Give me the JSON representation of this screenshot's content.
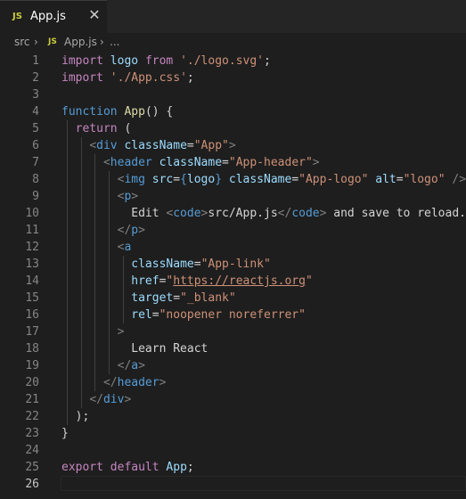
{
  "tab": {
    "icon_label": "JS",
    "file_name": "App.js",
    "close_glyph": "✕"
  },
  "breadcrumb": {
    "folder": "src",
    "sep1": "›",
    "icon_label": "JS",
    "file": "App.js",
    "sep2": "›",
    "ellipsis": "..."
  },
  "editor": {
    "line_numbers": [
      "1",
      "2",
      "3",
      "4",
      "5",
      "6",
      "7",
      "8",
      "9",
      "10",
      "11",
      "12",
      "13",
      "14",
      "15",
      "16",
      "17",
      "18",
      "19",
      "20",
      "21",
      "22",
      "23",
      "24",
      "25",
      "26"
    ],
    "active_line": 26,
    "lines": [
      [
        [
          "kw",
          "import"
        ],
        [
          "txt",
          " "
        ],
        [
          "var",
          "logo"
        ],
        [
          "txt",
          " "
        ],
        [
          "kw",
          "from"
        ],
        [
          "txt",
          " "
        ],
        [
          "str",
          "'./logo.svg'"
        ],
        [
          "txt",
          ";"
        ]
      ],
      [
        [
          "kw",
          "import"
        ],
        [
          "txt",
          " "
        ],
        [
          "str",
          "'./App.css'"
        ],
        [
          "txt",
          ";"
        ]
      ],
      [],
      [
        [
          "kw2",
          "function"
        ],
        [
          "txt",
          " "
        ],
        [
          "fn",
          "App"
        ],
        [
          "txt",
          "() {"
        ]
      ],
      [
        [
          "txt",
          "  "
        ],
        [
          "kw",
          "return"
        ],
        [
          "txt",
          " ("
        ]
      ],
      [
        [
          "txt",
          "    "
        ],
        [
          "punct",
          "<"
        ],
        [
          "tag",
          "div"
        ],
        [
          "txt",
          " "
        ],
        [
          "attr",
          "className"
        ],
        [
          "txt",
          "="
        ],
        [
          "str",
          "\"App\""
        ],
        [
          "punct",
          ">"
        ]
      ],
      [
        [
          "txt",
          "      "
        ],
        [
          "punct",
          "<"
        ],
        [
          "tag",
          "header"
        ],
        [
          "txt",
          " "
        ],
        [
          "attr",
          "className"
        ],
        [
          "txt",
          "="
        ],
        [
          "str",
          "\"App-header\""
        ],
        [
          "punct",
          ">"
        ]
      ],
      [
        [
          "txt",
          "        "
        ],
        [
          "punct",
          "<"
        ],
        [
          "tag",
          "img"
        ],
        [
          "txt",
          " "
        ],
        [
          "attr",
          "src"
        ],
        [
          "txt",
          "="
        ],
        [
          "kw2",
          "{"
        ],
        [
          "var",
          "logo"
        ],
        [
          "kw2",
          "}"
        ],
        [
          "txt",
          " "
        ],
        [
          "attr",
          "className"
        ],
        [
          "txt",
          "="
        ],
        [
          "str",
          "\"App-logo\""
        ],
        [
          "txt",
          " "
        ],
        [
          "attr",
          "alt"
        ],
        [
          "txt",
          "="
        ],
        [
          "str",
          "\"logo\""
        ],
        [
          "txt",
          " "
        ],
        [
          "punct",
          "/>"
        ]
      ],
      [
        [
          "txt",
          "        "
        ],
        [
          "punct",
          "<"
        ],
        [
          "tag",
          "p"
        ],
        [
          "punct",
          ">"
        ]
      ],
      [
        [
          "txt",
          "          Edit "
        ],
        [
          "punct",
          "<"
        ],
        [
          "tag",
          "code"
        ],
        [
          "punct",
          ">"
        ],
        [
          "txt",
          "src/App.js"
        ],
        [
          "punct",
          "</"
        ],
        [
          "tag",
          "code"
        ],
        [
          "punct",
          ">"
        ],
        [
          "txt",
          " and save to reload."
        ]
      ],
      [
        [
          "txt",
          "        "
        ],
        [
          "punct",
          "</"
        ],
        [
          "tag",
          "p"
        ],
        [
          "punct",
          ">"
        ]
      ],
      [
        [
          "txt",
          "        "
        ],
        [
          "punct",
          "<"
        ],
        [
          "tag",
          "a"
        ]
      ],
      [
        [
          "txt",
          "          "
        ],
        [
          "attr",
          "className"
        ],
        [
          "txt",
          "="
        ],
        [
          "str",
          "\"App-link\""
        ]
      ],
      [
        [
          "txt",
          "          "
        ],
        [
          "attr",
          "href"
        ],
        [
          "txt",
          "="
        ],
        [
          "str",
          "\""
        ],
        [
          "url",
          "https://reactjs.org"
        ],
        [
          "str",
          "\""
        ]
      ],
      [
        [
          "txt",
          "          "
        ],
        [
          "attr",
          "target"
        ],
        [
          "txt",
          "="
        ],
        [
          "str",
          "\"_blank\""
        ]
      ],
      [
        [
          "txt",
          "          "
        ],
        [
          "attr",
          "rel"
        ],
        [
          "txt",
          "="
        ],
        [
          "str",
          "\"noopener noreferrer\""
        ]
      ],
      [
        [
          "txt",
          "        "
        ],
        [
          "punct",
          ">"
        ]
      ],
      [
        [
          "txt",
          "          Learn React"
        ]
      ],
      [
        [
          "txt",
          "        "
        ],
        [
          "punct",
          "</"
        ],
        [
          "tag",
          "a"
        ],
        [
          "punct",
          ">"
        ]
      ],
      [
        [
          "txt",
          "      "
        ],
        [
          "punct",
          "</"
        ],
        [
          "tag",
          "header"
        ],
        [
          "punct",
          ">"
        ]
      ],
      [
        [
          "txt",
          "    "
        ],
        [
          "punct",
          "</"
        ],
        [
          "tag",
          "div"
        ],
        [
          "punct",
          ">"
        ]
      ],
      [
        [
          "txt",
          "  );"
        ]
      ],
      [
        [
          "txt",
          "}"
        ]
      ],
      [],
      [
        [
          "kw",
          "export"
        ],
        [
          "txt",
          " "
        ],
        [
          "kw",
          "default"
        ],
        [
          "txt",
          " "
        ],
        [
          "var",
          "App"
        ],
        [
          "txt",
          ";"
        ]
      ],
      []
    ]
  }
}
